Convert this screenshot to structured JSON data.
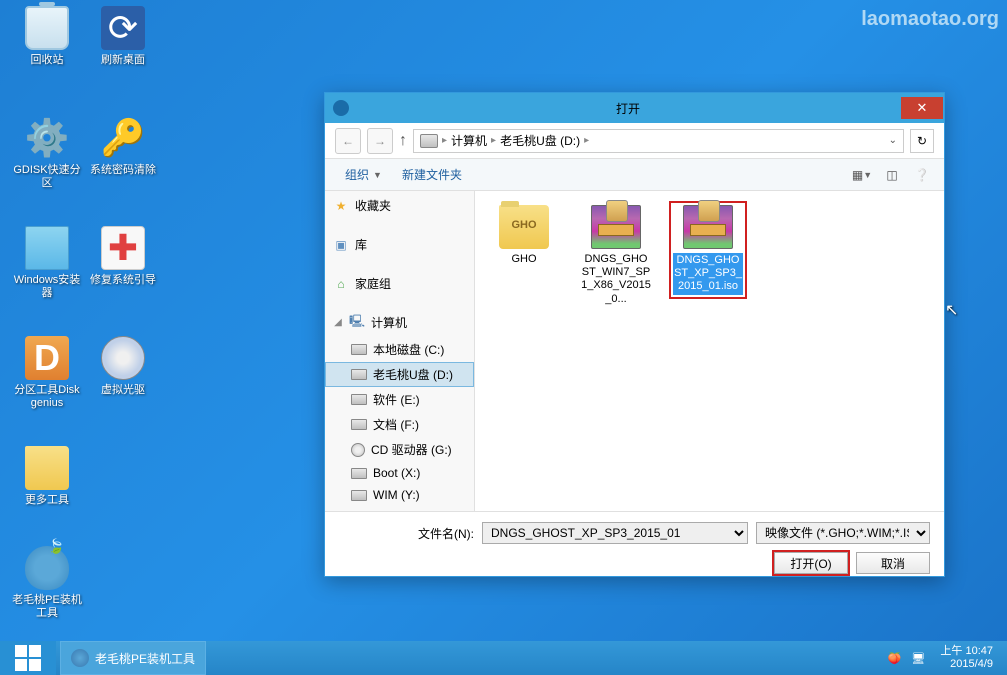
{
  "watermark": "laomaotao.org",
  "desktop": {
    "recycle": "回收站",
    "refresh": "刷新桌面",
    "gdisk": "GDISK快速分区",
    "syspass": "系统密码清除",
    "wininst": "Windows安装器",
    "repair": "修复系统引导",
    "diskgenius": "分区工具Diskgenius",
    "vcd": "虚拟光驱",
    "more": "更多工具",
    "petool": "老毛桃PE装机工具"
  },
  "dialog": {
    "title": "打开",
    "path_computer": "计算机",
    "path_drive": "老毛桃U盘 (D:)",
    "organize": "组织",
    "newfolder": "新建文件夹",
    "sidebar": {
      "fav": "收藏夹",
      "lib": "库",
      "home": "家庭组",
      "comp": "计算机",
      "drives": [
        "本地磁盘 (C:)",
        "老毛桃U盘 (D:)",
        "软件 (E:)",
        "文档 (F:)",
        "CD 驱动器 (G:)",
        "Boot (X:)",
        "WIM (Y:)"
      ]
    },
    "files": {
      "gho": "GHO",
      "win7": "DNGS_GHOST_WIN7_SP1_X86_V2015_0...",
      "xp": "DNGS_GHOST_XP_SP3_2015_01.iso"
    },
    "filename_label": "文件名(N):",
    "filename_value": "DNGS_GHOST_XP_SP3_2015_01",
    "filter": "映像文件 (*.GHO;*.WIM;*.ISO",
    "open_btn": "打开(O)",
    "cancel_btn": "取消"
  },
  "taskbar": {
    "app": "老毛桃PE装机工具",
    "time": "上午 10:47",
    "date": "2015/4/9"
  }
}
